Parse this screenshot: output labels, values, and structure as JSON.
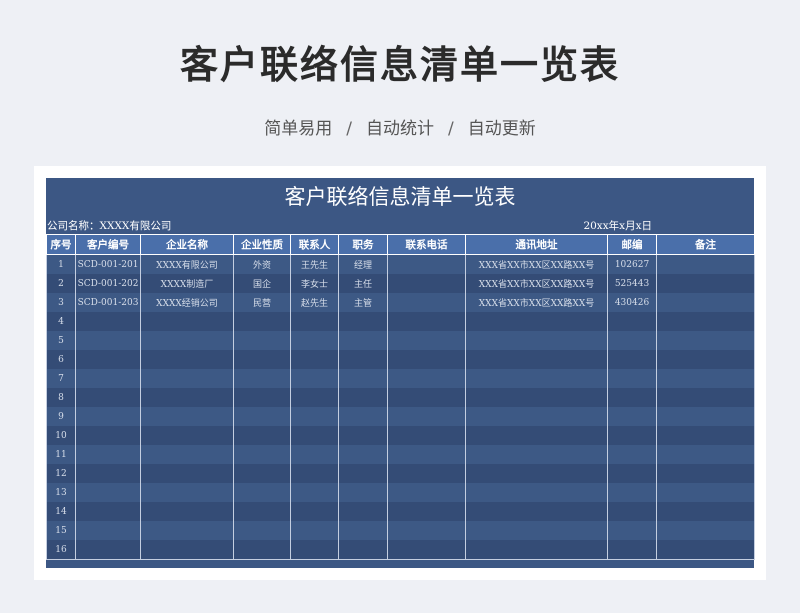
{
  "header": {
    "title": "客户联络信息清单一览表",
    "tagline": [
      "简单易用",
      "自动统计",
      "自动更新"
    ],
    "separator": "/"
  },
  "sheet": {
    "title": "客户联络信息清单一览表",
    "company_label": "公司名称：XXXX有限公司",
    "date_label": "20xx年x月x日",
    "columns": [
      "序号",
      "客户编号",
      "企业名称",
      "企业性质",
      "联系人",
      "职务",
      "联系电话",
      "通讯地址",
      "邮编",
      "备注"
    ],
    "rows": [
      [
        "1",
        "SCD-001-201",
        "XXXX有限公司",
        "外资",
        "王先生",
        "经理",
        "",
        "XXX省XX市XX区XX路XX号",
        "102627",
        ""
      ],
      [
        "2",
        "SCD-001-202",
        "XXXX制造厂",
        "国企",
        "李女士",
        "主任",
        "",
        "XXX省XX市XX区XX路XX号",
        "525443",
        ""
      ],
      [
        "3",
        "SCD-001-203",
        "XXXX经销公司",
        "民营",
        "赵先生",
        "主管",
        "",
        "XXX省XX市XX区XX路XX号",
        "430426",
        ""
      ],
      [
        "4",
        "",
        "",
        "",
        "",
        "",
        "",
        "",
        "",
        ""
      ],
      [
        "5",
        "",
        "",
        "",
        "",
        "",
        "",
        "",
        "",
        ""
      ],
      [
        "6",
        "",
        "",
        "",
        "",
        "",
        "",
        "",
        "",
        ""
      ],
      [
        "7",
        "",
        "",
        "",
        "",
        "",
        "",
        "",
        "",
        ""
      ],
      [
        "8",
        "",
        "",
        "",
        "",
        "",
        "",
        "",
        "",
        ""
      ],
      [
        "9",
        "",
        "",
        "",
        "",
        "",
        "",
        "",
        "",
        ""
      ],
      [
        "10",
        "",
        "",
        "",
        "",
        "",
        "",
        "",
        "",
        ""
      ],
      [
        "11",
        "",
        "",
        "",
        "",
        "",
        "",
        "",
        "",
        ""
      ],
      [
        "12",
        "",
        "",
        "",
        "",
        "",
        "",
        "",
        "",
        ""
      ],
      [
        "13",
        "",
        "",
        "",
        "",
        "",
        "",
        "",
        "",
        ""
      ],
      [
        "14",
        "",
        "",
        "",
        "",
        "",
        "",
        "",
        "",
        ""
      ],
      [
        "15",
        "",
        "",
        "",
        "",
        "",
        "",
        "",
        "",
        ""
      ],
      [
        "16",
        "",
        "",
        "",
        "",
        "",
        "",
        "",
        "",
        ""
      ]
    ]
  }
}
